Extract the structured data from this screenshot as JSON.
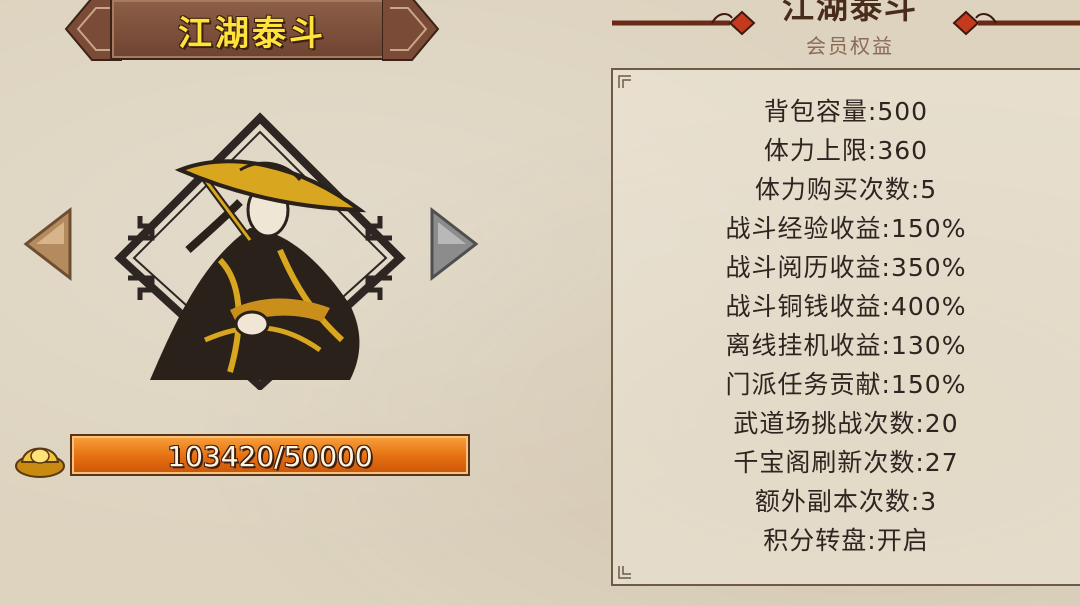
{
  "tier": {
    "title": "江湖泰斗"
  },
  "header_right": {
    "title": "江湖泰斗",
    "subtitle": "会员权益"
  },
  "currency": {
    "icon": "gold-ingot-icon",
    "progress_text": "103420/50000",
    "current": 103420,
    "required": 50000
  },
  "benefits": [
    "背包容量:500",
    "体力上限:360",
    "体力购买次数:5",
    "战斗经验收益:150%",
    "战斗阅历收益:350%",
    "战斗铜钱收益:400%",
    "离线挂机收益:130%",
    "门派任务贡献:150%",
    "武道场挑战次数:20",
    "千宝阁刷新次数:27",
    "额外副本次数:3",
    "积分转盘:开启"
  ],
  "colors": {
    "background": "#ddd3bf",
    "plaque": "#7a4b37",
    "title_text": "#ffe23a",
    "bar_orange": "#e8731a",
    "accent_red": "#c43a1c",
    "text_dark": "#2e2520"
  }
}
